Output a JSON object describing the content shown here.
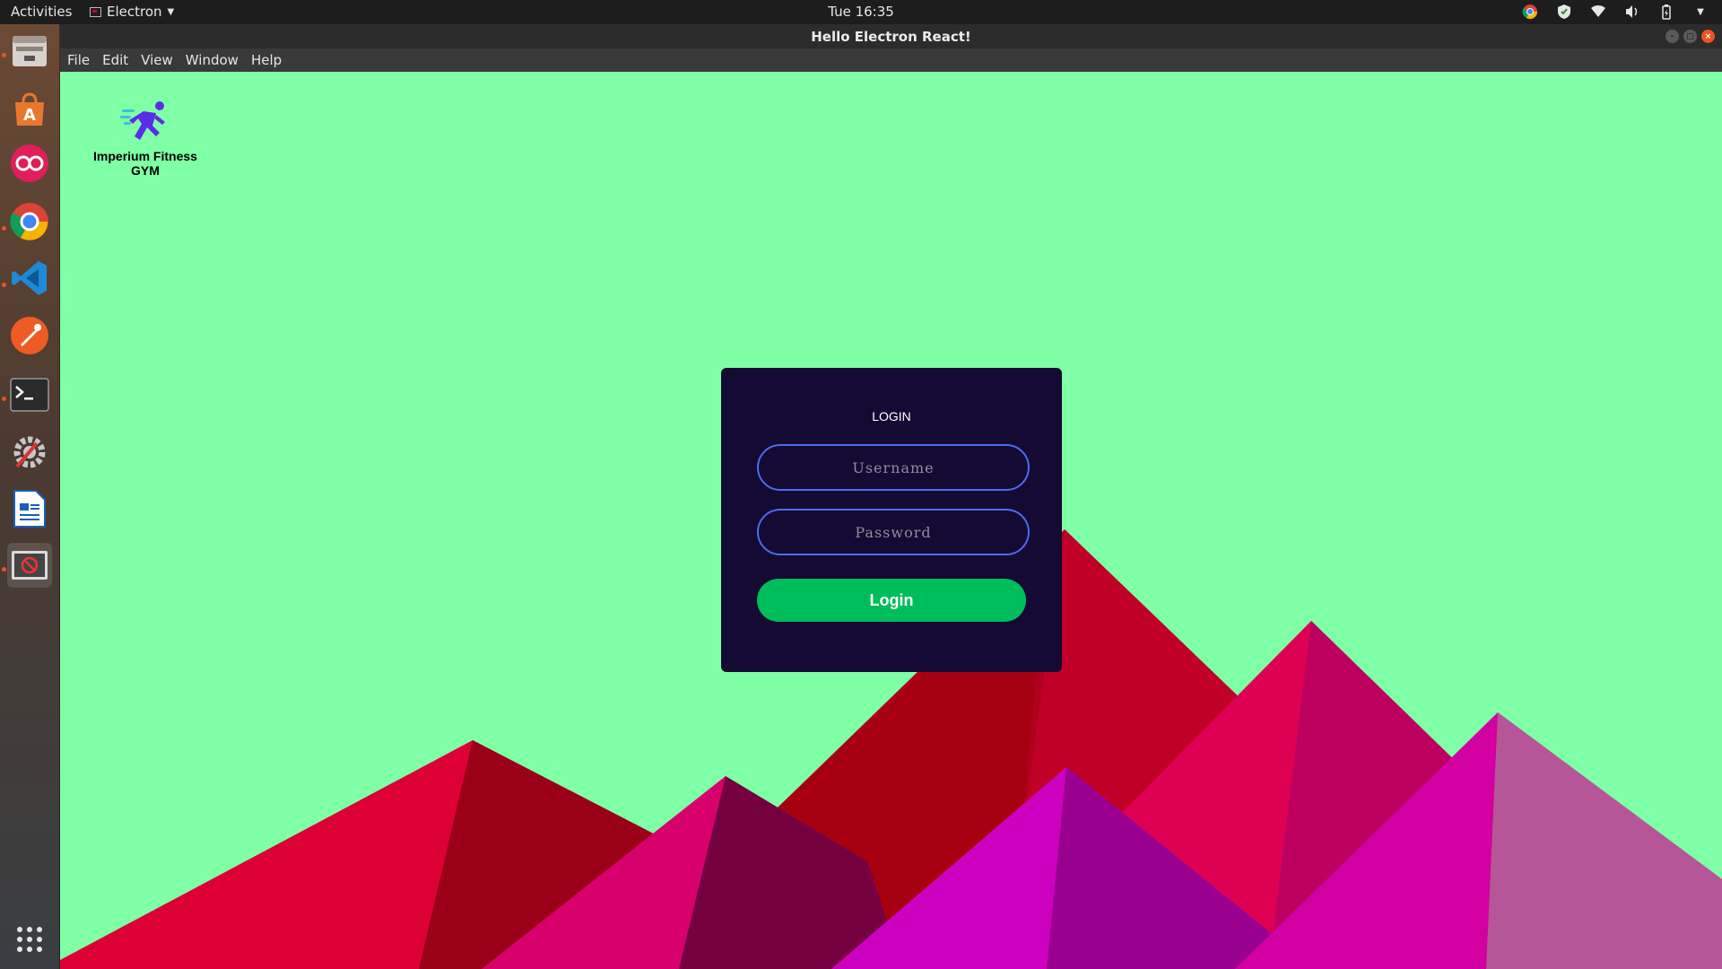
{
  "topbar": {
    "activities_label": "Activities",
    "app_menu_label": "Electron",
    "clock": "Tue 16:35",
    "tray_icons": [
      "chrome-icon",
      "shield-icon",
      "wifi-icon",
      "volume-icon",
      "battery-icon",
      "chevron-down-icon"
    ]
  },
  "dock": {
    "items": [
      "files-icon",
      "software-center-icon",
      "record-icon",
      "chrome-icon",
      "vscode-icon",
      "postman-icon",
      "terminal-icon",
      "settings-icon",
      "writer-icon",
      "blocked-app-icon"
    ],
    "show_apps_icon": "grid-icon"
  },
  "window": {
    "title": "Hello Electron React!",
    "menu": [
      "File",
      "Edit",
      "View",
      "Window",
      "Help"
    ]
  },
  "brand": {
    "name": "Imperium Fitness GYM",
    "logo_icon": "running-man-icon"
  },
  "login": {
    "heading": "LOGIN",
    "username_placeholder": "Username",
    "password_placeholder": "Password",
    "button_label": "Login"
  },
  "colors": {
    "background": "#7fffa6",
    "card": "#140a33",
    "button": "#00bd5c",
    "input_border": "#4a6cf0"
  }
}
